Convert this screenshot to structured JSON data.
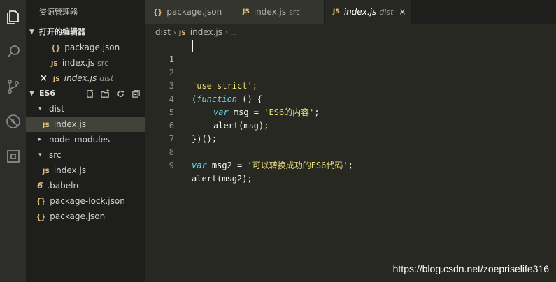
{
  "sidebar": {
    "title": "资源管理器",
    "open_editors_label": "打开的编辑器",
    "open_editors": [
      {
        "icon": "{}",
        "name": "package.json",
        "hint": ""
      },
      {
        "icon": "JS",
        "name": "index.js",
        "hint": "src"
      },
      {
        "icon": "JS",
        "name": "index.js",
        "hint": "dist",
        "close": "×"
      }
    ],
    "project_label": "ES6",
    "tree": [
      {
        "name": "dist",
        "kind": "folder",
        "caret": "▾"
      },
      {
        "name": "index.js",
        "kind": "js"
      },
      {
        "name": "node_modules",
        "kind": "folder",
        "caret": "▸"
      },
      {
        "name": "src",
        "kind": "folder",
        "caret": "▾"
      },
      {
        "name": "index.js",
        "kind": "js"
      },
      {
        "name": ".babelrc",
        "kind": "babel",
        "icon": "6"
      },
      {
        "name": "package-lock.json",
        "kind": "json",
        "icon": "{}"
      },
      {
        "name": "package.json",
        "kind": "json",
        "icon": "{}"
      }
    ]
  },
  "tabs": [
    {
      "icon": "{}",
      "name": "package.json",
      "hint": ""
    },
    {
      "icon": "JS",
      "name": "index.js",
      "hint": "src"
    },
    {
      "icon": "JS",
      "name": "index.js",
      "hint": "dist",
      "close": "×"
    }
  ],
  "breadcrumb": {
    "folder": "dist",
    "sep": "›",
    "file_icon": "JS",
    "file": "index.js",
    "trail": "› ..."
  },
  "editor": {
    "line_numbers": [
      "1",
      "2",
      "3",
      "4",
      "5",
      "6",
      "7",
      "8",
      "9"
    ],
    "l1": "'use strict';",
    "l3_a": "(function",
    "l3_b": " () {",
    "l4_k": "var",
    "l4_v": " msg = ",
    "l4_s": "'ES6的内容'",
    "l4_e": ";",
    "l5": "alert(msg);",
    "l6": "})();",
    "l8_k": "var",
    "l8_v": " msg2 = ",
    "l8_s": "'可以转换成功的ES6代码'",
    "l8_e": ";",
    "l9": "alert(msg2);"
  },
  "watermark": "https://blog.csdn.net/zoepriselife316",
  "colors": {
    "keyword": "#66d9ef",
    "string": "#e6db74",
    "icon_js": "#e5c07b",
    "background": "#272822"
  }
}
